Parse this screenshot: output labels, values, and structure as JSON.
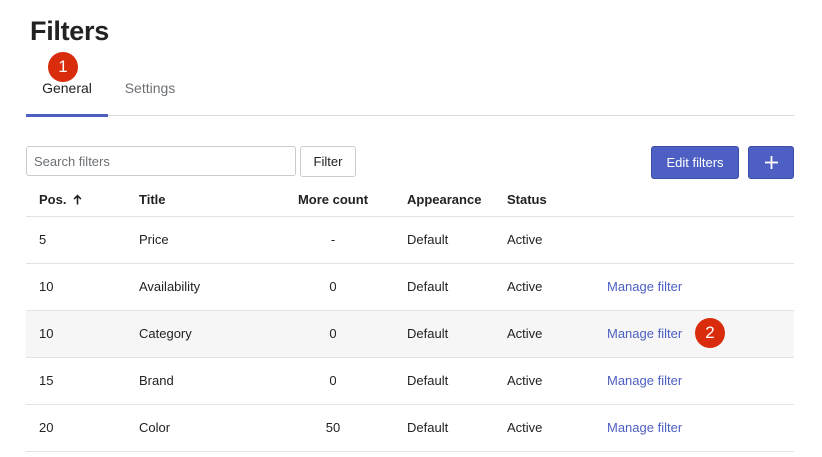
{
  "page": {
    "title": "Filters"
  },
  "tabs": [
    {
      "label": "General",
      "active": true
    },
    {
      "label": "Settings",
      "active": false
    }
  ],
  "annotations": {
    "badge_1": "1",
    "badge_2": "2"
  },
  "toolbar": {
    "search_placeholder": "Search filters",
    "search_value": "",
    "filter_label": "Filter",
    "edit_filters_label": "Edit filters",
    "add_icon": "plus-icon"
  },
  "table": {
    "columns": {
      "pos": "Pos.",
      "title": "Title",
      "more_count": "More count",
      "appearance": "Appearance",
      "status": "Status"
    },
    "sort": {
      "column": "pos",
      "direction": "ascending",
      "icon": "arrow-up-icon"
    },
    "rows": [
      {
        "pos": "5",
        "title": "Price",
        "more_count": "-",
        "appearance": "Default",
        "status": "Active",
        "action": ""
      },
      {
        "pos": "10",
        "title": "Availability",
        "more_count": "0",
        "appearance": "Default",
        "status": "Active",
        "action": "Manage filter"
      },
      {
        "pos": "10",
        "title": "Category",
        "more_count": "0",
        "appearance": "Default",
        "status": "Active",
        "action": "Manage filter"
      },
      {
        "pos": "15",
        "title": "Brand",
        "more_count": "0",
        "appearance": "Default",
        "status": "Active",
        "action": "Manage filter"
      },
      {
        "pos": "20",
        "title": "Color",
        "more_count": "50",
        "appearance": "Default",
        "status": "Active",
        "action": "Manage filter"
      }
    ]
  },
  "colors": {
    "accent": "#4d5fc2",
    "badge": "#d82c0d",
    "row_alt": "#f6f6f7"
  }
}
